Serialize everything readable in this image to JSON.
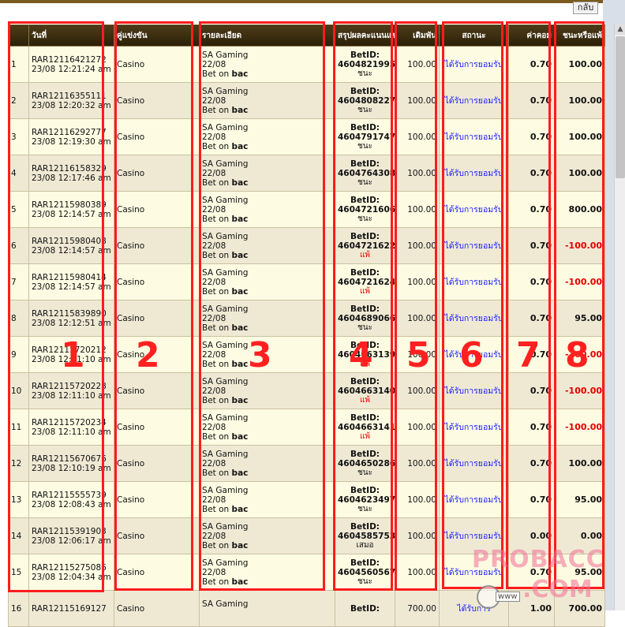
{
  "back_label": "กลับ",
  "headers": [
    "",
    "วันที่",
    "คู่แข่งขัน",
    "รายละเอียด",
    "สรุปผลคะแนนแข่ง",
    "เดิมพัน",
    "สถานะ",
    "ค่าคอม",
    "ชนะหรือแพ้"
  ],
  "rows": [
    {
      "n": "1",
      "id": "RAR12116421272",
      "dt": "23/08 12:21:24 am",
      "match": "Casino",
      "prov": "SA Gaming",
      "date": "22/08",
      "bet_prefix": "Bet on",
      "bet_on": "bac",
      "betid_label": "BetID:",
      "betid": "4604821995",
      "result": "ชนะ",
      "lose": false,
      "stake": "100.00",
      "status": "ได้รับการยอมรับ",
      "comm": "0.70",
      "wl": "100.00",
      "neg": false
    },
    {
      "n": "2",
      "id": "RAR12116355111",
      "dt": "23/08 12:20:32 am",
      "match": "Casino",
      "prov": "SA Gaming",
      "date": "22/08",
      "bet_prefix": "Bet on",
      "bet_on": "bac",
      "betid_label": "BetID:",
      "betid": "4604808227",
      "result": "ชนะ",
      "lose": false,
      "stake": "100.00",
      "status": "ได้รับการยอมรับ",
      "comm": "0.70",
      "wl": "100.00",
      "neg": false
    },
    {
      "n": "3",
      "id": "RAR12116292777",
      "dt": "23/08 12:19:30 am",
      "match": "Casino",
      "prov": "SA Gaming",
      "date": "22/08",
      "bet_prefix": "Bet on",
      "bet_on": "bac",
      "betid_label": "BetID:",
      "betid": "4604791747",
      "result": "ชนะ",
      "lose": false,
      "stake": "100.00",
      "status": "ได้รับการยอมรับ",
      "comm": "0.70",
      "wl": "100.00",
      "neg": false
    },
    {
      "n": "4",
      "id": "RAR12116158329",
      "dt": "23/08 12:17:46 am",
      "match": "Casino",
      "prov": "SA Gaming",
      "date": "22/08",
      "bet_prefix": "Bet on",
      "bet_on": "bac",
      "betid_label": "BetID:",
      "betid": "4604764308",
      "result": "ชนะ",
      "lose": false,
      "stake": "100.00",
      "status": "ได้รับการยอมรับ",
      "comm": "0.70",
      "wl": "100.00",
      "neg": false
    },
    {
      "n": "5",
      "id": "RAR12115980389",
      "dt": "23/08 12:14:57 am",
      "match": "Casino",
      "prov": "SA Gaming",
      "date": "22/08",
      "bet_prefix": "Bet on",
      "bet_on": "bac",
      "betid_label": "BetID:",
      "betid": "4604721606",
      "result": "ชนะ",
      "lose": false,
      "stake": "100.00",
      "status": "ได้รับการยอมรับ",
      "comm": "0.70",
      "wl": "800.00",
      "neg": false
    },
    {
      "n": "6",
      "id": "RAR12115980408",
      "dt": "23/08 12:14:57 am",
      "match": "Casino",
      "prov": "SA Gaming",
      "date": "22/08",
      "bet_prefix": "Bet on",
      "bet_on": "bac",
      "betid_label": "BetID:",
      "betid": "4604721622",
      "result": "แพ้",
      "lose": true,
      "stake": "100.00",
      "status": "ได้รับการยอมรับ",
      "comm": "0.70",
      "wl": "-100.00",
      "neg": true
    },
    {
      "n": "7",
      "id": "RAR12115980414",
      "dt": "23/08 12:14:57 am",
      "match": "Casino",
      "prov": "SA Gaming",
      "date": "22/08",
      "bet_prefix": "Bet on",
      "bet_on": "bac",
      "betid_label": "BetID:",
      "betid": "4604721624",
      "result": "แพ้",
      "lose": true,
      "stake": "100.00",
      "status": "ได้รับการยอมรับ",
      "comm": "0.70",
      "wl": "-100.00",
      "neg": true
    },
    {
      "n": "8",
      "id": "RAR12115839890",
      "dt": "23/08 12:12:51 am",
      "match": "Casino",
      "prov": "SA Gaming",
      "date": "22/08",
      "bet_prefix": "Bet on",
      "bet_on": "bac",
      "betid_label": "BetID:",
      "betid": "4604689066",
      "result": "ชนะ",
      "lose": false,
      "stake": "100.00",
      "status": "ได้รับการยอมรับ",
      "comm": "0.70",
      "wl": "95.00",
      "neg": false
    },
    {
      "n": "9",
      "id": "RAR12115720212",
      "dt": "23/08 12:11:10 am",
      "match": "Casino",
      "prov": "SA Gaming",
      "date": "22/08",
      "bet_prefix": "Bet on",
      "bet_on": "bac",
      "betid_label": "BetID:",
      "betid": "4604663139",
      "result": "แพ้",
      "lose": true,
      "stake": "100.00",
      "status": "ได้รับการยอมรับ",
      "comm": "0.70",
      "wl": "-100.00",
      "neg": true
    },
    {
      "n": "10",
      "id": "RAR12115720228",
      "dt": "23/08 12:11:10 am",
      "match": "Casino",
      "prov": "SA Gaming",
      "date": "22/08",
      "bet_prefix": "Bet on",
      "bet_on": "bac",
      "betid_label": "BetID:",
      "betid": "4604663140",
      "result": "แพ้",
      "lose": true,
      "stake": "100.00",
      "status": "ได้รับการยอมรับ",
      "comm": "0.70",
      "wl": "-100.00",
      "neg": true
    },
    {
      "n": "11",
      "id": "RAR12115720234",
      "dt": "23/08 12:11:10 am",
      "match": "Casino",
      "prov": "SA Gaming",
      "date": "22/08",
      "bet_prefix": "Bet on",
      "bet_on": "bac",
      "betid_label": "BetID:",
      "betid": "4604663141",
      "result": "แพ้",
      "lose": true,
      "stake": "100.00",
      "status": "ได้รับการยอมรับ",
      "comm": "0.70",
      "wl": "-100.00",
      "neg": true
    },
    {
      "n": "12",
      "id": "RAR12115670676",
      "dt": "23/08 12:10:19 am",
      "match": "Casino",
      "prov": "SA Gaming",
      "date": "22/08",
      "bet_prefix": "Bet on",
      "bet_on": "bac",
      "betid_label": "BetID:",
      "betid": "4604650286",
      "result": "ชนะ",
      "lose": false,
      "stake": "100.00",
      "status": "ได้รับการยอมรับ",
      "comm": "0.70",
      "wl": "100.00",
      "neg": false
    },
    {
      "n": "13",
      "id": "RAR12115555739",
      "dt": "23/08 12:08:43 am",
      "match": "Casino",
      "prov": "SA Gaming",
      "date": "22/08",
      "bet_prefix": "Bet on",
      "bet_on": "bac",
      "betid_label": "BetID:",
      "betid": "4604623497",
      "result": "ชนะ",
      "lose": false,
      "stake": "100.00",
      "status": "ได้รับการยอมรับ",
      "comm": "0.70",
      "wl": "95.00",
      "neg": false
    },
    {
      "n": "14",
      "id": "RAR12115391903",
      "dt": "23/08 12:06:17 am",
      "match": "Casino",
      "prov": "SA Gaming",
      "date": "22/08",
      "bet_prefix": "Bet on",
      "bet_on": "bac",
      "betid_label": "BetID:",
      "betid": "4604585753",
      "result": "เสมอ",
      "lose": false,
      "stake": "100.00",
      "status": "ได้รับการยอมรับ",
      "comm": "0.00",
      "wl": "0.00",
      "neg": false
    },
    {
      "n": "15",
      "id": "RAR12115275086",
      "dt": "23/08 12:04:34 am",
      "match": "Casino",
      "prov": "SA Gaming",
      "date": "22/08",
      "bet_prefix": "Bet on",
      "bet_on": "bac",
      "betid_label": "BetID:",
      "betid": "4604560567",
      "result": "ชนะ",
      "lose": false,
      "stake": "100.00",
      "status": "ได้รับการยอมรับ",
      "comm": "0.70",
      "wl": "95.00",
      "neg": false
    },
    {
      "n": "16",
      "id": "RAR12115169127",
      "dt": "",
      "match": "Casino",
      "prov": "SA Gaming",
      "date": "",
      "bet_prefix": "",
      "bet_on": "",
      "betid_label": "BetID:",
      "betid": "",
      "result": "",
      "lose": false,
      "stake": "700.00",
      "status": "ได้รับการ",
      "comm": "1.00",
      "wl": "700.00",
      "neg": false
    }
  ],
  "annotations": [
    "1",
    "2",
    "3",
    "4",
    "5",
    "6",
    "7",
    "8"
  ],
  "watermark": {
    "line1": "PROBACC",
    "line2": ".COM",
    "www": "www"
  },
  "colors": {
    "header_bg": "#3b2d10",
    "accent_red": "#ff1c1c",
    "status_blue": "#1a1aff",
    "row_odd": "#fdfbe2",
    "row_even": "#efe9d4"
  }
}
